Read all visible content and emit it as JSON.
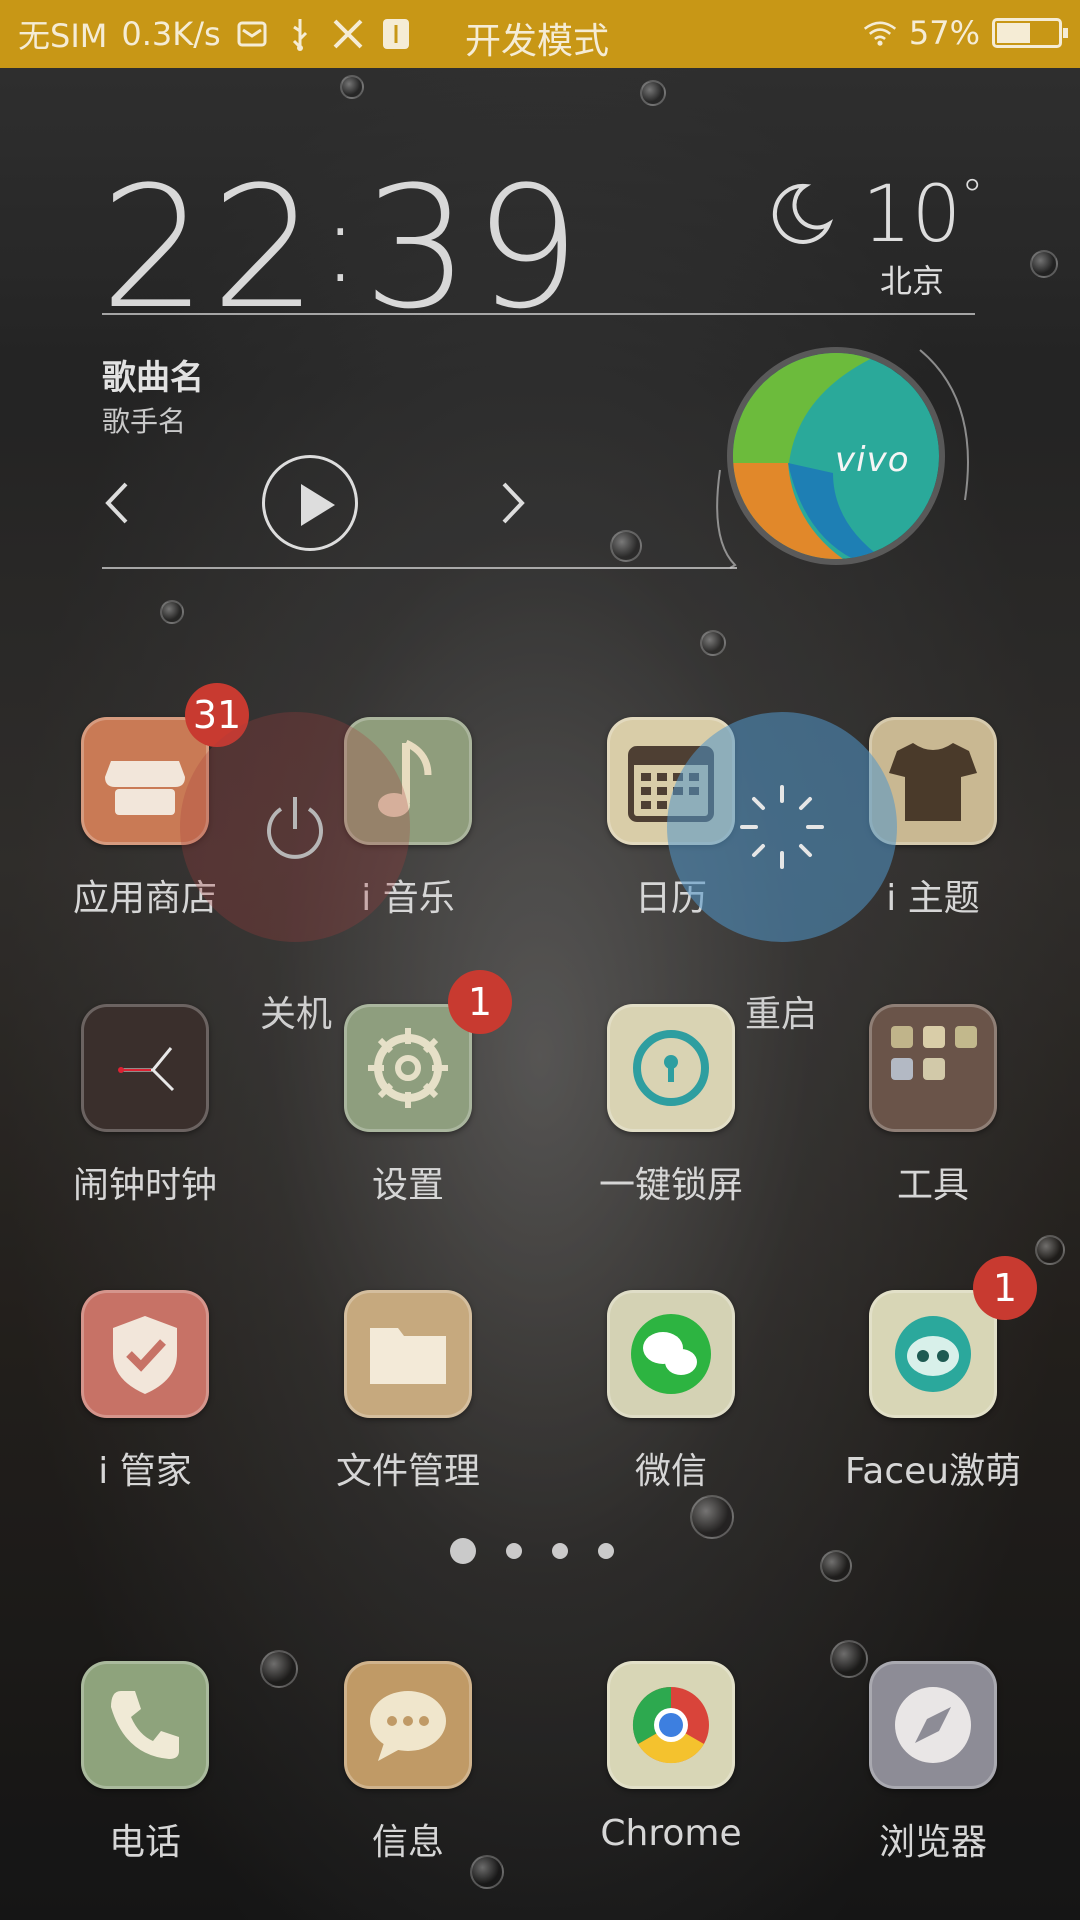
{
  "status_bar": {
    "sim": "无SIM",
    "speed": "0.3K/s",
    "title": "开发模式",
    "battery": "57%",
    "battery_level": 0.57,
    "color": "#c89716"
  },
  "clock": {
    "hour": "22",
    "minute": "39",
    "separator": ":"
  },
  "weather": {
    "temp": "10",
    "degree": "°",
    "city": "北京",
    "icon": "moon-icon"
  },
  "music": {
    "song": "歌曲名",
    "artist": "歌手名"
  },
  "vivo": {
    "logo_text": "vivo"
  },
  "overlays": {
    "power_label": "关机",
    "restart_label": "重启"
  },
  "apps": [
    {
      "label": "应用商店",
      "badge": "31",
      "icon": "store-icon",
      "color": "#c97a55"
    },
    {
      "label": "i 音乐",
      "icon": "music-note-icon",
      "color": "#8f9d7c"
    },
    {
      "label": "日历",
      "icon": "calendar-icon",
      "color": "#d9cda8"
    },
    {
      "label": "i 主题",
      "icon": "tshirt-icon",
      "color": "#c9b892"
    },
    {
      "label": "闹钟时钟",
      "icon": "clock-icon",
      "color": "#3a2f2c"
    },
    {
      "label": "设置",
      "badge": "1",
      "icon": "gear-icon",
      "color": "#8e9e7e"
    },
    {
      "label": "一键锁屏",
      "icon": "lock-screen-icon",
      "color": "#d9d3b3"
    },
    {
      "label": "工具",
      "icon": "tools-folder-icon",
      "color": "#6a5449"
    },
    {
      "label": "i 管家",
      "icon": "shield-icon",
      "color": "#c77266"
    },
    {
      "label": "文件管理",
      "icon": "folder-icon",
      "color": "#c6a97e"
    },
    {
      "label": "微信",
      "icon": "wechat-icon",
      "color": "#d4d2b4"
    },
    {
      "label": "Faceu激萌",
      "badge": "1",
      "icon": "faceu-icon",
      "color": "#d8d6b6"
    }
  ],
  "dock": [
    {
      "label": "电话",
      "icon": "phone-icon",
      "color": "#8ea37c"
    },
    {
      "label": "信息",
      "icon": "message-icon",
      "color": "#c09a66"
    },
    {
      "label": "Chrome",
      "icon": "chrome-icon",
      "color": "#d8d6b6"
    },
    {
      "label": "浏览器",
      "icon": "compass-icon",
      "color": "#8d8c96"
    }
  ],
  "pages": {
    "count": 4,
    "active": 1
  }
}
